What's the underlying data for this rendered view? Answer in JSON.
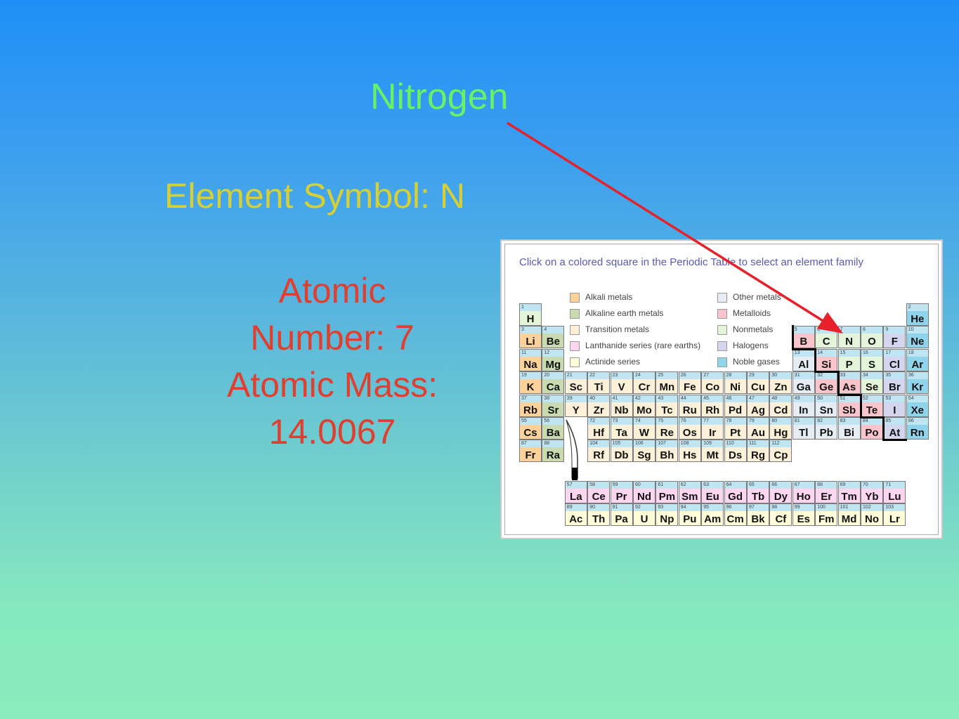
{
  "slide": {
    "title": "Nitrogen",
    "symbol_line": "Element Symbol: N",
    "info_lines": [
      "Atomic",
      "Number: 7",
      "Atomic Mass:",
      "14.0067"
    ],
    "colors": {
      "title": "#66f266",
      "symbol": "#d6cf36",
      "info": "#e03f2e",
      "arrow": "#e8202a"
    }
  },
  "periodic_table": {
    "instruction": "Click on a colored square in the Periodic Table to select an element family",
    "legend": [
      {
        "label": "Alkali metals",
        "family": "alkali"
      },
      {
        "label": "Alkaline earth metals",
        "family": "alkaline"
      },
      {
        "label": "Transition metals",
        "family": "transition"
      },
      {
        "label": "Lanthanide series (rare earths)",
        "family": "lanth"
      },
      {
        "label": "Actinide series",
        "family": "actin"
      },
      {
        "label": "Other metals",
        "family": "other"
      },
      {
        "label": "Metalloids",
        "family": "metalloid"
      },
      {
        "label": "Nonmetals",
        "family": "nonmetal"
      },
      {
        "label": "Halogens",
        "family": "halogen"
      },
      {
        "label": "Noble gases",
        "family": "noble"
      }
    ],
    "elements": [
      {
        "n": 1,
        "s": "H",
        "f": "nonmetal",
        "p": 1,
        "g": 1
      },
      {
        "n": 2,
        "s": "He",
        "f": "noble",
        "p": 1,
        "g": 18
      },
      {
        "n": 3,
        "s": "Li",
        "f": "alkali",
        "p": 2,
        "g": 1
      },
      {
        "n": 4,
        "s": "Be",
        "f": "alkaline",
        "p": 2,
        "g": 2
      },
      {
        "n": 5,
        "s": "B",
        "f": "metalloid",
        "p": 2,
        "g": 13
      },
      {
        "n": 6,
        "s": "C",
        "f": "nonmetal",
        "p": 2,
        "g": 14
      },
      {
        "n": 7,
        "s": "N",
        "f": "nonmetal",
        "p": 2,
        "g": 15
      },
      {
        "n": 8,
        "s": "O",
        "f": "nonmetal",
        "p": 2,
        "g": 16
      },
      {
        "n": 9,
        "s": "F",
        "f": "halogen",
        "p": 2,
        "g": 17
      },
      {
        "n": 10,
        "s": "Ne",
        "f": "noble",
        "p": 2,
        "g": 18
      },
      {
        "n": 11,
        "s": "Na",
        "f": "alkali",
        "p": 3,
        "g": 1
      },
      {
        "n": 12,
        "s": "Mg",
        "f": "alkaline",
        "p": 3,
        "g": 2
      },
      {
        "n": 13,
        "s": "Al",
        "f": "other",
        "p": 3,
        "g": 13
      },
      {
        "n": 14,
        "s": "Si",
        "f": "metalloid",
        "p": 3,
        "g": 14
      },
      {
        "n": 15,
        "s": "P",
        "f": "nonmetal",
        "p": 3,
        "g": 15
      },
      {
        "n": 16,
        "s": "S",
        "f": "nonmetal",
        "p": 3,
        "g": 16
      },
      {
        "n": 17,
        "s": "Cl",
        "f": "halogen",
        "p": 3,
        "g": 17
      },
      {
        "n": 18,
        "s": "Ar",
        "f": "noble",
        "p": 3,
        "g": 18
      },
      {
        "n": 19,
        "s": "K",
        "f": "alkali",
        "p": 4,
        "g": 1
      },
      {
        "n": 20,
        "s": "Ca",
        "f": "alkaline",
        "p": 4,
        "g": 2
      },
      {
        "n": 21,
        "s": "Sc",
        "f": "transition",
        "p": 4,
        "g": 3
      },
      {
        "n": 22,
        "s": "Ti",
        "f": "transition",
        "p": 4,
        "g": 4
      },
      {
        "n": 23,
        "s": "V",
        "f": "transition",
        "p": 4,
        "g": 5
      },
      {
        "n": 24,
        "s": "Cr",
        "f": "transition",
        "p": 4,
        "g": 6
      },
      {
        "n": 25,
        "s": "Mn",
        "f": "transition",
        "p": 4,
        "g": 7
      },
      {
        "n": 26,
        "s": "Fe",
        "f": "transition",
        "p": 4,
        "g": 8
      },
      {
        "n": 27,
        "s": "Co",
        "f": "transition",
        "p": 4,
        "g": 9
      },
      {
        "n": 28,
        "s": "Ni",
        "f": "transition",
        "p": 4,
        "g": 10
      },
      {
        "n": 29,
        "s": "Cu",
        "f": "transition",
        "p": 4,
        "g": 11
      },
      {
        "n": 30,
        "s": "Zn",
        "f": "transition",
        "p": 4,
        "g": 12
      },
      {
        "n": 31,
        "s": "Ga",
        "f": "other",
        "p": 4,
        "g": 13
      },
      {
        "n": 32,
        "s": "Ge",
        "f": "metalloid",
        "p": 4,
        "g": 14
      },
      {
        "n": 33,
        "s": "As",
        "f": "metalloid",
        "p": 4,
        "g": 15
      },
      {
        "n": 34,
        "s": "Se",
        "f": "nonmetal",
        "p": 4,
        "g": 16
      },
      {
        "n": 35,
        "s": "Br",
        "f": "halogen",
        "p": 4,
        "g": 17
      },
      {
        "n": 36,
        "s": "Kr",
        "f": "noble",
        "p": 4,
        "g": 18
      },
      {
        "n": 37,
        "s": "Rb",
        "f": "alkali",
        "p": 5,
        "g": 1
      },
      {
        "n": 38,
        "s": "Sr",
        "f": "alkaline",
        "p": 5,
        "g": 2
      },
      {
        "n": 39,
        "s": "Y",
        "f": "transition",
        "p": 5,
        "g": 3
      },
      {
        "n": 40,
        "s": "Zr",
        "f": "transition",
        "p": 5,
        "g": 4
      },
      {
        "n": 41,
        "s": "Nb",
        "f": "transition",
        "p": 5,
        "g": 5
      },
      {
        "n": 42,
        "s": "Mo",
        "f": "transition",
        "p": 5,
        "g": 6
      },
      {
        "n": 43,
        "s": "Tc",
        "f": "transition",
        "p": 5,
        "g": 7
      },
      {
        "n": 44,
        "s": "Ru",
        "f": "transition",
        "p": 5,
        "g": 8
      },
      {
        "n": 45,
        "s": "Rh",
        "f": "transition",
        "p": 5,
        "g": 9
      },
      {
        "n": 46,
        "s": "Pd",
        "f": "transition",
        "p": 5,
        "g": 10
      },
      {
        "n": 47,
        "s": "Ag",
        "f": "transition",
        "p": 5,
        "g": 11
      },
      {
        "n": 48,
        "s": "Cd",
        "f": "transition",
        "p": 5,
        "g": 12
      },
      {
        "n": 49,
        "s": "In",
        "f": "other",
        "p": 5,
        "g": 13
      },
      {
        "n": 50,
        "s": "Sn",
        "f": "other",
        "p": 5,
        "g": 14
      },
      {
        "n": 51,
        "s": "Sb",
        "f": "metalloid",
        "p": 5,
        "g": 15
      },
      {
        "n": 52,
        "s": "Te",
        "f": "metalloid",
        "p": 5,
        "g": 16
      },
      {
        "n": 53,
        "s": "I",
        "f": "halogen",
        "p": 5,
        "g": 17
      },
      {
        "n": 54,
        "s": "Xe",
        "f": "noble",
        "p": 5,
        "g": 18
      },
      {
        "n": 55,
        "s": "Cs",
        "f": "alkali",
        "p": 6,
        "g": 1
      },
      {
        "n": 56,
        "s": "Ba",
        "f": "alkaline",
        "p": 6,
        "g": 2
      },
      {
        "n": 72,
        "s": "Hf",
        "f": "transition",
        "p": 6,
        "g": 4
      },
      {
        "n": 73,
        "s": "Ta",
        "f": "transition",
        "p": 6,
        "g": 5
      },
      {
        "n": 74,
        "s": "W",
        "f": "transition",
        "p": 6,
        "g": 6
      },
      {
        "n": 75,
        "s": "Re",
        "f": "transition",
        "p": 6,
        "g": 7
      },
      {
        "n": 76,
        "s": "Os",
        "f": "transition",
        "p": 6,
        "g": 8
      },
      {
        "n": 77,
        "s": "Ir",
        "f": "transition",
        "p": 6,
        "g": 9
      },
      {
        "n": 78,
        "s": "Pt",
        "f": "transition",
        "p": 6,
        "g": 10
      },
      {
        "n": 79,
        "s": "Au",
        "f": "transition",
        "p": 6,
        "g": 11
      },
      {
        "n": 80,
        "s": "Hg",
        "f": "transition",
        "p": 6,
        "g": 12
      },
      {
        "n": 81,
        "s": "Tl",
        "f": "other",
        "p": 6,
        "g": 13
      },
      {
        "n": 82,
        "s": "Pb",
        "f": "other",
        "p": 6,
        "g": 14
      },
      {
        "n": 83,
        "s": "Bi",
        "f": "other",
        "p": 6,
        "g": 15
      },
      {
        "n": 84,
        "s": "Po",
        "f": "metalloid",
        "p": 6,
        "g": 16
      },
      {
        "n": 85,
        "s": "At",
        "f": "halogen",
        "p": 6,
        "g": 17
      },
      {
        "n": 86,
        "s": "Rn",
        "f": "noble",
        "p": 6,
        "g": 18
      },
      {
        "n": 87,
        "s": "Fr",
        "f": "alkali",
        "p": 7,
        "g": 1
      },
      {
        "n": 88,
        "s": "Ra",
        "f": "alkaline",
        "p": 7,
        "g": 2
      },
      {
        "n": 104,
        "s": "Rf",
        "f": "transition",
        "p": 7,
        "g": 4
      },
      {
        "n": 105,
        "s": "Db",
        "f": "transition",
        "p": 7,
        "g": 5
      },
      {
        "n": 106,
        "s": "Sg",
        "f": "transition",
        "p": 7,
        "g": 6
      },
      {
        "n": 107,
        "s": "Bh",
        "f": "transition",
        "p": 7,
        "g": 7
      },
      {
        "n": 108,
        "s": "Hs",
        "f": "transition",
        "p": 7,
        "g": 8
      },
      {
        "n": 109,
        "s": "Mt",
        "f": "transition",
        "p": 7,
        "g": 9
      },
      {
        "n": 110,
        "s": "Ds",
        "f": "transition",
        "p": 7,
        "g": 10
      },
      {
        "n": 111,
        "s": "Rg",
        "f": "transition",
        "p": 7,
        "g": 11
      },
      {
        "n": 112,
        "s": "Cp",
        "f": "transition",
        "p": 7,
        "g": 12
      },
      {
        "n": 57,
        "s": "La",
        "f": "lanth",
        "p": 8,
        "g": 3
      },
      {
        "n": 58,
        "s": "Ce",
        "f": "lanth",
        "p": 8,
        "g": 4
      },
      {
        "n": 59,
        "s": "Pr",
        "f": "lanth",
        "p": 8,
        "g": 5
      },
      {
        "n": 60,
        "s": "Nd",
        "f": "lanth",
        "p": 8,
        "g": 6
      },
      {
        "n": 61,
        "s": "Pm",
        "f": "lanth",
        "p": 8,
        "g": 7
      },
      {
        "n": 62,
        "s": "Sm",
        "f": "lanth",
        "p": 8,
        "g": 8
      },
      {
        "n": 63,
        "s": "Eu",
        "f": "lanth",
        "p": 8,
        "g": 9
      },
      {
        "n": 64,
        "s": "Gd",
        "f": "lanth",
        "p": 8,
        "g": 10
      },
      {
        "n": 65,
        "s": "Tb",
        "f": "lanth",
        "p": 8,
        "g": 11
      },
      {
        "n": 66,
        "s": "Dy",
        "f": "lanth",
        "p": 8,
        "g": 12
      },
      {
        "n": 67,
        "s": "Ho",
        "f": "lanth",
        "p": 8,
        "g": 13
      },
      {
        "n": 68,
        "s": "Er",
        "f": "lanth",
        "p": 8,
        "g": 14
      },
      {
        "n": 69,
        "s": "Tm",
        "f": "lanth",
        "p": 8,
        "g": 15
      },
      {
        "n": 70,
        "s": "Yb",
        "f": "lanth",
        "p": 8,
        "g": 16
      },
      {
        "n": 71,
        "s": "Lu",
        "f": "lanth",
        "p": 8,
        "g": 17
      },
      {
        "n": 89,
        "s": "Ac",
        "f": "actin",
        "p": 9,
        "g": 3
      },
      {
        "n": 90,
        "s": "Th",
        "f": "actin",
        "p": 9,
        "g": 4
      },
      {
        "n": 91,
        "s": "Pa",
        "f": "actin",
        "p": 9,
        "g": 5
      },
      {
        "n": 92,
        "s": "U",
        "f": "actin",
        "p": 9,
        "g": 6
      },
      {
        "n": 93,
        "s": "Np",
        "f": "actin",
        "p": 9,
        "g": 7
      },
      {
        "n": 94,
        "s": "Pu",
        "f": "actin",
        "p": 9,
        "g": 8
      },
      {
        "n": 95,
        "s": "Am",
        "f": "actin",
        "p": 9,
        "g": 9
      },
      {
        "n": 96,
        "s": "Cm",
        "f": "actin",
        "p": 9,
        "g": 10
      },
      {
        "n": 97,
        "s": "Bk",
        "f": "actin",
        "p": 9,
        "g": 11
      },
      {
        "n": 98,
        "s": "Cf",
        "f": "actin",
        "p": 9,
        "g": 12
      },
      {
        "n": 99,
        "s": "Es",
        "f": "actin",
        "p": 9,
        "g": 13
      },
      {
        "n": 100,
        "s": "Fm",
        "f": "actin",
        "p": 9,
        "g": 14
      },
      {
        "n": 101,
        "s": "Md",
        "f": "actin",
        "p": 9,
        "g": 15
      },
      {
        "n": 102,
        "s": "No",
        "f": "actin",
        "p": 9,
        "g": 16
      },
      {
        "n": 103,
        "s": "Lr",
        "f": "actin",
        "p": 9,
        "g": 17
      }
    ]
  }
}
